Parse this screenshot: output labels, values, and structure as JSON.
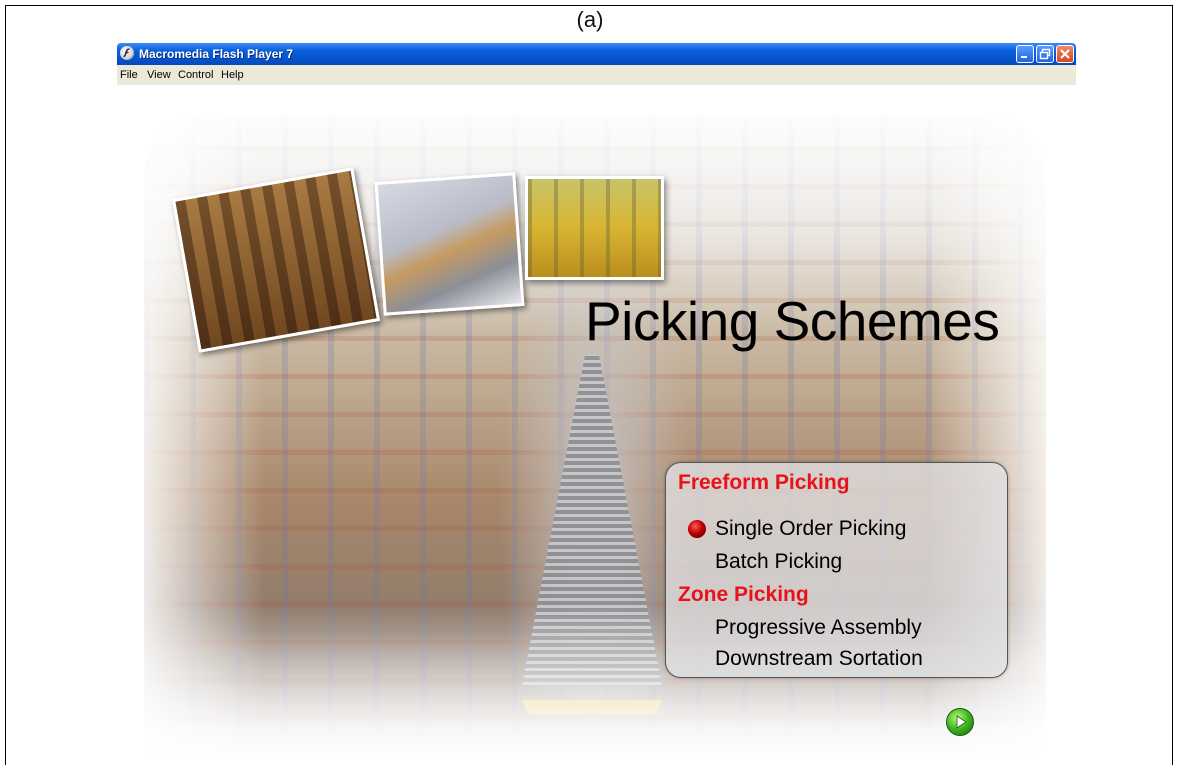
{
  "caption": "(a)",
  "window": {
    "title": "Macromedia Flash Player 7",
    "menu": [
      "File",
      "View",
      "Control",
      "Help"
    ]
  },
  "content": {
    "heading": "Picking Schemes",
    "sections": [
      {
        "label": "Freeform Picking",
        "items": [
          "Single Order Picking",
          "Batch Picking"
        ]
      },
      {
        "label": "Zone Picking",
        "items": [
          "Progressive Assembly",
          "Downstream Sortation"
        ]
      }
    ],
    "selected_item": "Single Order Picking"
  },
  "colors": {
    "section_red": "#e8121b",
    "titlebar_blue": "#0454d0"
  },
  "icons": [
    "flash-player-icon",
    "minimize-icon",
    "restore-icon",
    "close-icon",
    "bullet-icon",
    "play-icon"
  ]
}
